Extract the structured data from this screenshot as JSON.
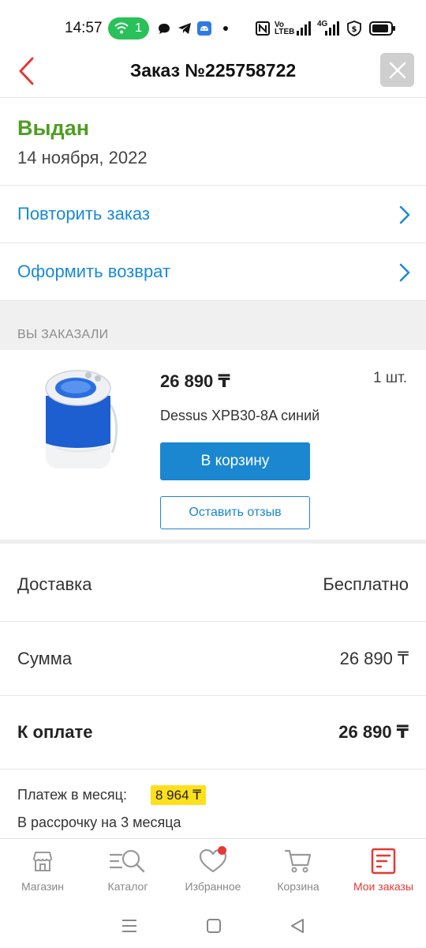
{
  "statusbar": {
    "time": "14:57",
    "wifi_count": "1",
    "volte_line1": "Vo",
    "volte_line2": "LTEB",
    "network": "4G"
  },
  "header": {
    "title": "Заказ №225758722"
  },
  "order_status": {
    "label": "Выдан",
    "date": "14 ноября, 2022",
    "color": "#4f9d22"
  },
  "actions": [
    {
      "label": "Повторить заказ"
    },
    {
      "label": "Оформить возврат"
    }
  ],
  "ordered_section": {
    "title": "ВЫ ЗАКАЗАЛИ"
  },
  "product": {
    "price": "26 890 ₸",
    "quantity": "1 шт.",
    "name": "Dessus XPB30-8A синий",
    "cart_button": "В корзину",
    "review_button": "Оставить отзыв"
  },
  "summary": {
    "delivery_label": "Доставка",
    "delivery_value": "Бесплатно",
    "sum_label": "Сумма",
    "sum_value": "26 890 ₸",
    "total_label": "К оплате",
    "total_value": "26 890 ₸"
  },
  "installment": {
    "label": "Платеж в месяц:",
    "amount": "8 964 ₸",
    "subtitle": "В рассрочку на 3 месяца"
  },
  "bottom_nav": [
    {
      "label": "Магазин",
      "icon": "shop-icon"
    },
    {
      "label": "Каталог",
      "icon": "catalog-search-icon"
    },
    {
      "label": "Избранное",
      "icon": "heart-icon"
    },
    {
      "label": "Корзина",
      "icon": "cart-icon"
    },
    {
      "label": "Мои заказы",
      "icon": "orders-icon",
      "active": true
    }
  ],
  "colors": {
    "accent_blue": "#1a87d0",
    "accent_red": "#e53935",
    "status_green": "#4f9d22",
    "installment_yellow": "#ffe01b"
  }
}
